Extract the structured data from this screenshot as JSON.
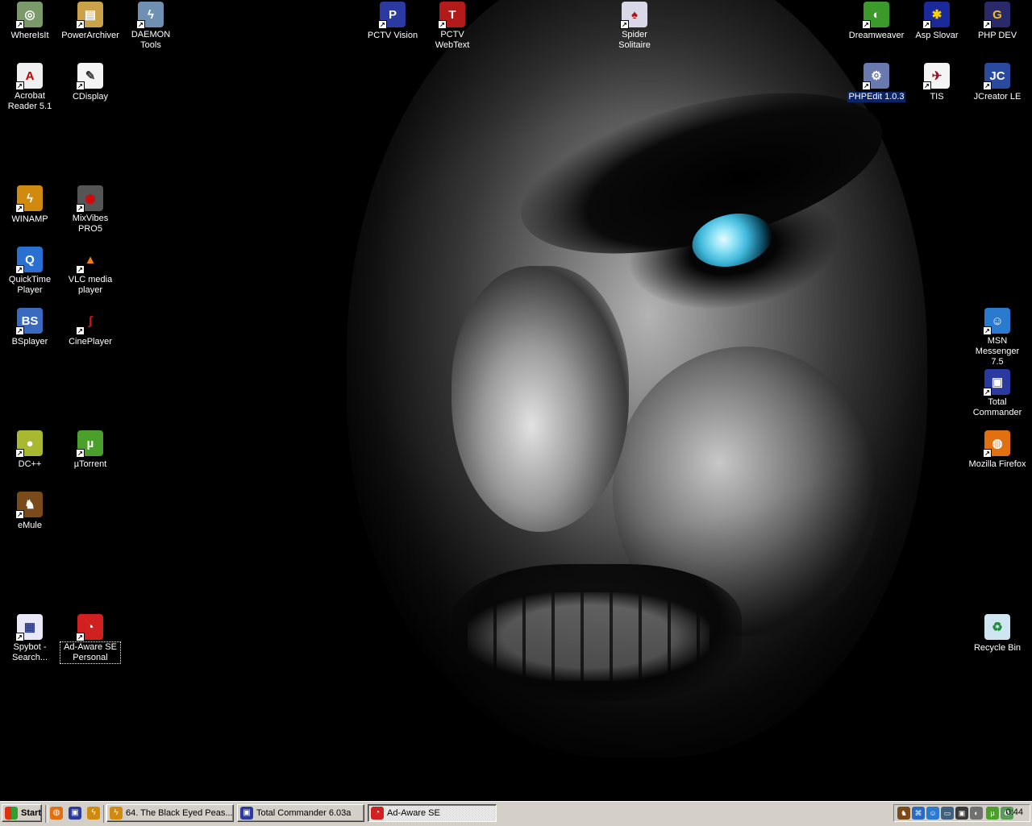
{
  "desktop": {
    "icons": [
      {
        "label": "WhereIsIt",
        "glyph": "◎",
        "color": "#7a9a6a",
        "text": "#fff"
      },
      {
        "label": "PowerArchiver",
        "glyph": "▤",
        "color": "#c9a24a",
        "text": "#fff"
      },
      {
        "label": "DAEMON Tools",
        "glyph": "ϟ",
        "color": "#6f8fb3",
        "text": "#fff"
      },
      {
        "label": "PCTV Vision",
        "glyph": "P",
        "color": "#2b3aa0",
        "text": "#fff"
      },
      {
        "label": "PCTV WebText",
        "glyph": "T",
        "color": "#b31a1a",
        "text": "#fff"
      },
      {
        "label": "Spider Solitaire",
        "glyph": "♠",
        "color": "#d8d8e8",
        "text": "#b01010"
      },
      {
        "label": "Dreamweaver",
        "glyph": "◐",
        "color": "#3c9a2a",
        "text": "#fff"
      },
      {
        "label": "Asp Slovar",
        "glyph": "✱",
        "color": "#1a2a9a",
        "text": "#ffd200"
      },
      {
        "label": "PHP DEV",
        "glyph": "G",
        "color": "#2a2a6a",
        "text": "#f0c020"
      },
      {
        "label": "Acrobat Reader 5.1",
        "glyph": "A",
        "color": "#f0f0f0",
        "text": "#c00000"
      },
      {
        "label": "CDisplay",
        "glyph": "✎",
        "color": "#f4f4f4",
        "text": "#333"
      },
      {
        "label": "PHPEdit 1.0.3",
        "glyph": "⚙",
        "color": "#6a7ab0",
        "text": "#fff"
      },
      {
        "label": "TIS",
        "glyph": "✈",
        "color": "#f4f4f4",
        "text": "#a01020"
      },
      {
        "label": "JCreator LE",
        "glyph": "JC",
        "color": "#2a4aa0",
        "text": "#fff"
      },
      {
        "label": "WINAMP",
        "glyph": "ϟ",
        "color": "#d08a10",
        "text": "#fff"
      },
      {
        "label": "MixVibes PRO5",
        "glyph": "◉",
        "color": "#555",
        "text": "#d00"
      },
      {
        "label": "QuickTime Player",
        "glyph": "Q",
        "color": "#2a70d0",
        "text": "#fff"
      },
      {
        "label": "VLC media player",
        "glyph": "▲",
        "color": "#000",
        "text": "#f08010"
      },
      {
        "label": "BSplayer",
        "glyph": "BS",
        "color": "#3a6ac0",
        "text": "#fff"
      },
      {
        "label": "CinePlayer",
        "glyph": "ʃ",
        "color": "#000",
        "text": "#e01010"
      },
      {
        "label": "MSN Messenger 7.5",
        "glyph": "☺",
        "color": "#2a7ad0",
        "text": "#fff"
      },
      {
        "label": "Total Commander",
        "glyph": "▣",
        "color": "#2a3aa0",
        "text": "#fff"
      },
      {
        "label": "DC++",
        "glyph": "●",
        "color": "#a8b830",
        "text": "#fff"
      },
      {
        "label": "µTorrent",
        "glyph": "µ",
        "color": "#4aa02a",
        "text": "#fff"
      },
      {
        "label": "Mozilla Firefox",
        "glyph": "◍",
        "color": "#e07010",
        "text": "#fff"
      },
      {
        "label": "eMule",
        "glyph": "♞",
        "color": "#7a4a1a",
        "text": "#fff"
      },
      {
        "label": "Spybot - Search...",
        "glyph": "▦",
        "color": "#e8e8f8",
        "text": "#2a3a8a"
      },
      {
        "label": "Ad-Aware SE Personal",
        "glyph": "◔",
        "color": "#d02020",
        "text": "#fff"
      },
      {
        "label": "Recycle Bin",
        "glyph": "♻",
        "color": "#cfe6f0",
        "text": "#1a8a3a"
      }
    ]
  },
  "taskbar": {
    "start_label": "Start",
    "quick_launch": [
      {
        "name": "firefox-icon",
        "glyph": "◍",
        "color": "#e07010",
        "text": "#fff"
      },
      {
        "name": "save-icon",
        "glyph": "▣",
        "color": "#2a3aa0",
        "text": "#fff"
      },
      {
        "name": "winamp-icon",
        "glyph": "ϟ",
        "color": "#d08a10",
        "text": "#fff"
      }
    ],
    "tasks": [
      {
        "label": "64. The Black Eyed Peas...",
        "glyph": "ϟ",
        "color": "#d08a10",
        "text": "#fff"
      },
      {
        "label": "Total Commander 6.03a",
        "glyph": "▣",
        "color": "#2a3aa0",
        "text": "#fff"
      },
      {
        "label": "Ad-Aware SE",
        "glyph": "◔",
        "color": "#d02020",
        "text": "#fff"
      }
    ],
    "tray_icons": [
      {
        "name": "tray-emule-icon",
        "glyph": "♞",
        "color": "#7a4a1a"
      },
      {
        "name": "tray-network-icon",
        "glyph": "⌘",
        "color": "#2a6ac0"
      },
      {
        "name": "tray-msn-icon",
        "glyph": "☺",
        "color": "#2a7ad0"
      },
      {
        "name": "tray-display-icon",
        "glyph": "▭",
        "color": "#406080"
      },
      {
        "name": "tray-monitor-icon",
        "glyph": "▣",
        "color": "#3a3a3a"
      },
      {
        "name": "tray-volume-icon",
        "glyph": "◐",
        "color": "#707070"
      },
      {
        "name": "tray-utorrent-icon",
        "glyph": "µ",
        "color": "#4aa02a"
      },
      {
        "name": "tray-recycle-icon",
        "glyph": "♻",
        "color": "#5a9a5a"
      }
    ],
    "clock": "0:44"
  }
}
